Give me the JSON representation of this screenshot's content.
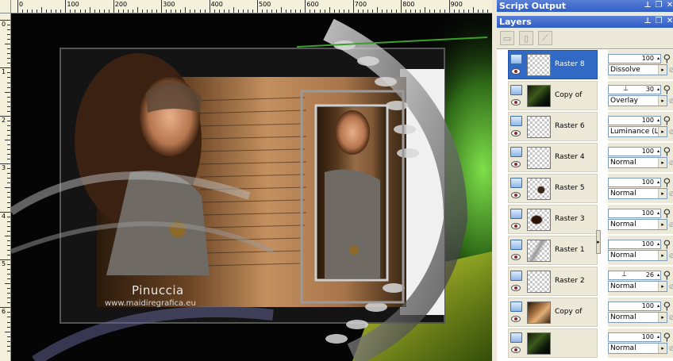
{
  "ruler": {
    "top_labels": [
      "0",
      "100",
      "200",
      "300",
      "400",
      "500",
      "600",
      "700",
      "800",
      "900"
    ],
    "left_labels": [
      "0",
      "1",
      "2",
      "3",
      "4",
      "5",
      "6"
    ]
  },
  "artwork": {
    "signature": "Pinuccia",
    "url": "www.maidiregrafica.eu"
  },
  "panels": {
    "script_output_title": "Script Output",
    "layers_title": "Layers"
  },
  "layers": [
    {
      "name": "Raster 8",
      "selected": true,
      "opacity": "100",
      "blend": "Dissolve",
      "thumb": "transparent"
    },
    {
      "name": "Copy of",
      "selected": false,
      "opacity": "30",
      "blend": "Overlay",
      "thumb": "photo-green"
    },
    {
      "name": "Raster 6",
      "selected": false,
      "opacity": "100",
      "blend": "Luminance (L)",
      "thumb": "transparent"
    },
    {
      "name": "Raster 4",
      "selected": false,
      "opacity": "100",
      "blend": "Normal",
      "thumb": "transparent"
    },
    {
      "name": "Raster 5",
      "selected": false,
      "opacity": "100",
      "blend": "Normal",
      "thumb": "dark-mark"
    },
    {
      "name": "Raster 3",
      "selected": false,
      "opacity": "100",
      "blend": "Normal",
      "thumb": "face-mark"
    },
    {
      "name": "Raster 1",
      "selected": false,
      "opacity": "100",
      "blend": "Normal",
      "thumb": "streak"
    },
    {
      "name": "Raster 2",
      "selected": false,
      "opacity": "26",
      "blend": "Normal",
      "thumb": "transparent"
    },
    {
      "name": "Copy of",
      "selected": false,
      "opacity": "100",
      "blend": "Normal",
      "thumb": "photo-warm"
    },
    {
      "name": "",
      "selected": false,
      "opacity": "100",
      "blend": "Normal",
      "thumb": "photo-green"
    }
  ],
  "colors": {
    "title_bar": "#2f5fc6",
    "selected_layer": "#316ac5",
    "panel_bg": "#ece9d8"
  }
}
